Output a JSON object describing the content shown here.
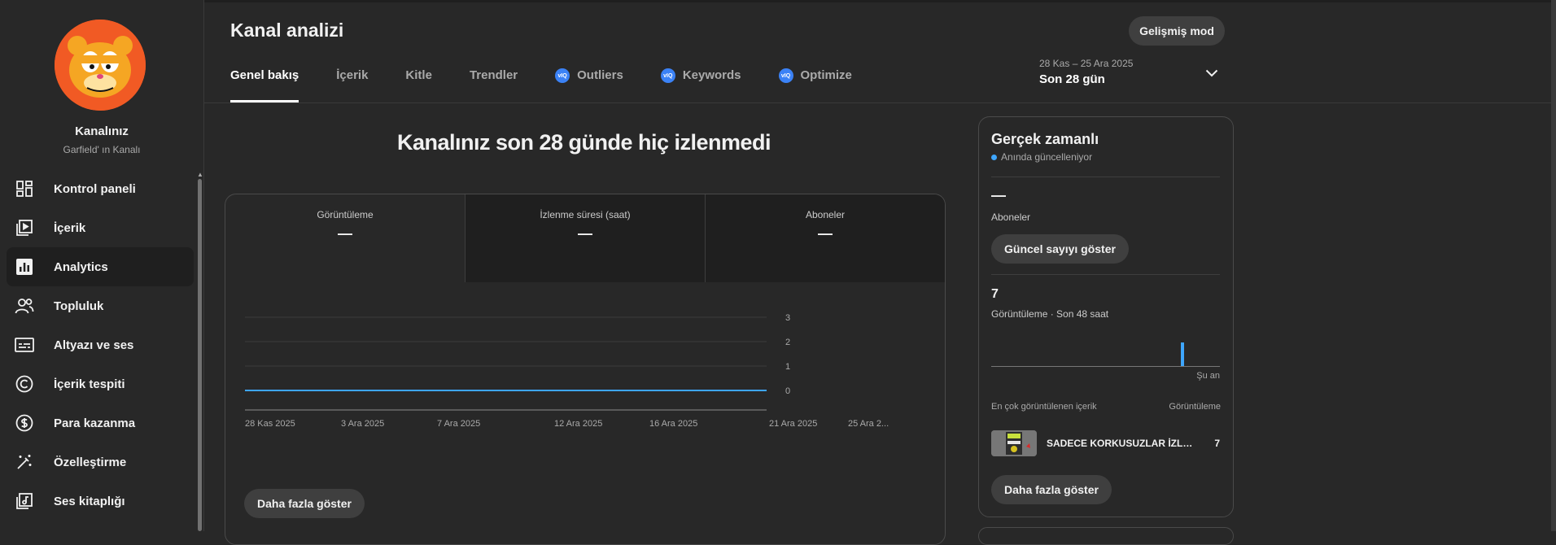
{
  "sidebar": {
    "channel_name": "Kanalınız",
    "channel_subtitle": "Garfield' ın Kanalı",
    "items": [
      {
        "label": "Kontrol paneli",
        "icon": "dashboard-icon"
      },
      {
        "label": "İçerik",
        "icon": "content-play-icon"
      },
      {
        "label": "Analytics",
        "icon": "analytics-bar-icon",
        "active": true
      },
      {
        "label": "Topluluk",
        "icon": "community-people-icon"
      },
      {
        "label": "Altyazı ve ses",
        "icon": "subtitles-icon"
      },
      {
        "label": "İçerik tespiti",
        "icon": "copyright-icon"
      },
      {
        "label": "Para kazanma",
        "icon": "dollar-circle-icon"
      },
      {
        "label": "Özelleştirme",
        "icon": "magic-wand-icon"
      },
      {
        "label": "Ses kitaplığı",
        "icon": "audio-library-icon"
      }
    ]
  },
  "header": {
    "title": "Kanal analizi",
    "advanced_mode": "Gelişmiş mod",
    "tabs": [
      {
        "label": "Genel bakış",
        "active": true,
        "ext": false
      },
      {
        "label": "İçerik",
        "ext": false
      },
      {
        "label": "Kitle",
        "ext": false
      },
      {
        "label": "Trendler",
        "ext": false
      },
      {
        "label": "Outliers",
        "ext": true
      },
      {
        "label": "Keywords",
        "ext": true
      },
      {
        "label": "Optimize",
        "ext": true
      }
    ],
    "date_range": "28 Kas – 25 Ara 2025",
    "date_label": "Son 28 gün"
  },
  "main": {
    "headline": "Kanalınız son 28 günde hiç izlenmedi",
    "metrics": [
      {
        "title": "Görüntüleme",
        "value": "—"
      },
      {
        "title": "İzlenme süresi (saat)",
        "value": "—"
      },
      {
        "title": "Aboneler",
        "value": "—"
      }
    ],
    "show_more": "Daha fazla göster"
  },
  "chart_data": {
    "type": "line",
    "x": [
      "28 Kas 2025",
      "3 Ara 2025",
      "7 Ara 2025",
      "12 Ara 2025",
      "16 Ara 2025",
      "21 Ara 2025",
      "25 Ara 2..."
    ],
    "series": [
      {
        "values": [
          0,
          0,
          0,
          0,
          0,
          0,
          0
        ],
        "color": "#3ea6ff"
      }
    ],
    "y_ticks": [
      0,
      1,
      2,
      3
    ],
    "ylim": [
      0,
      3
    ],
    "grid": true
  },
  "realtime": {
    "title": "Gerçek zamanlı",
    "subtitle": "Anında güncelleniyor",
    "subscribers_value": "—",
    "subscribers_label": "Aboneler",
    "show_count": "Güncel sayıyı göster",
    "views_value": "7",
    "views_label": "Görüntüleme · Son 48 saat",
    "now_label": "Şu an",
    "top_content_header": "En çok görüntülenen içerik",
    "views_header": "Görüntüleme",
    "top_video": {
      "title": "SADECE KORKUSUZLAR İZLE...",
      "views": "7"
    },
    "show_more": "Daha fazla göster"
  },
  "colors": {
    "accent": "#3ea6ff",
    "avatar_bg": "#f15a24",
    "ext_badge": "#3b82f6"
  }
}
